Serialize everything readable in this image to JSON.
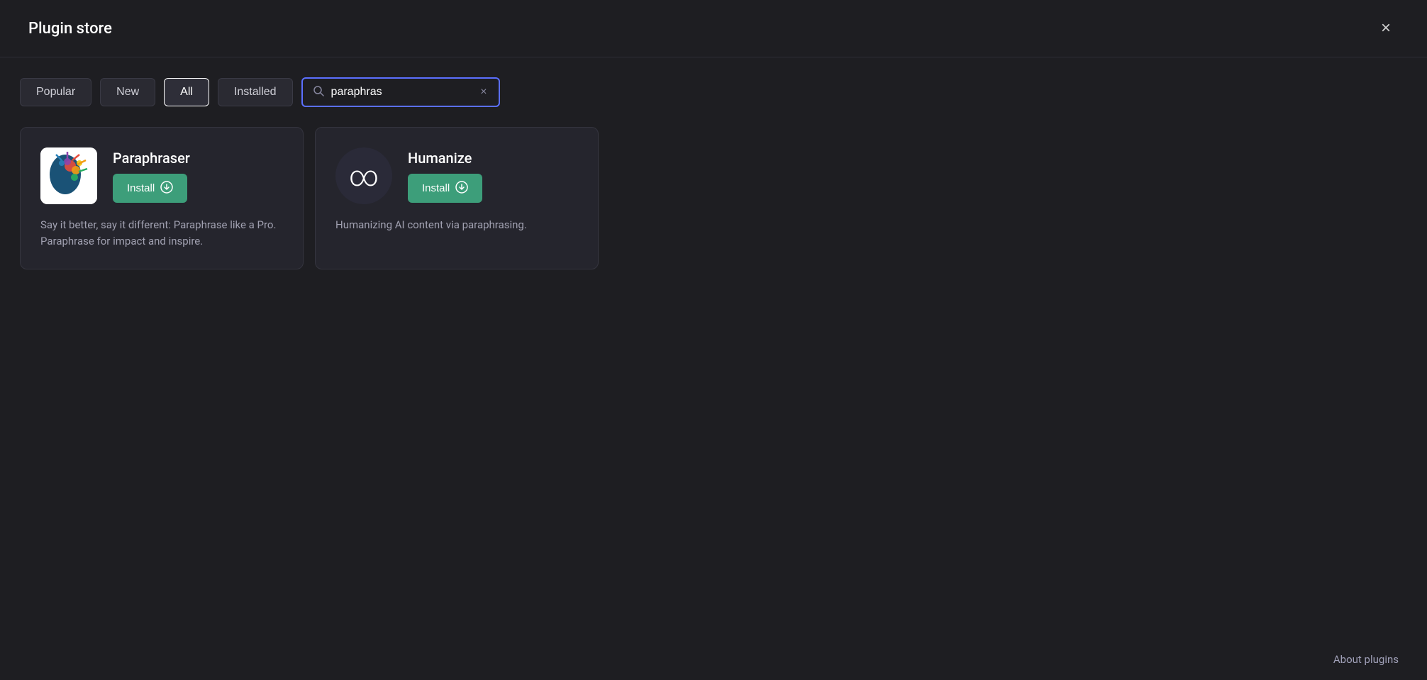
{
  "header": {
    "title": "Plugin store",
    "close_label": "×"
  },
  "filters": {
    "popular_label": "Popular",
    "new_label": "New",
    "all_label": "All",
    "installed_label": "Installed",
    "active": "all"
  },
  "search": {
    "placeholder": "Search plugins",
    "value": "paraphras",
    "clear_label": "×"
  },
  "plugins": [
    {
      "id": "paraphraser",
      "name": "Paraphraser",
      "description": "Say it better, say it different: Paraphrase like a Pro. Paraphrase for impact and inspire.",
      "install_label": "Install"
    },
    {
      "id": "humanize",
      "name": "Humanize",
      "description": "Humanizing AI content via paraphrasing.",
      "install_label": "Install"
    }
  ],
  "footer": {
    "about_label": "About plugins"
  }
}
